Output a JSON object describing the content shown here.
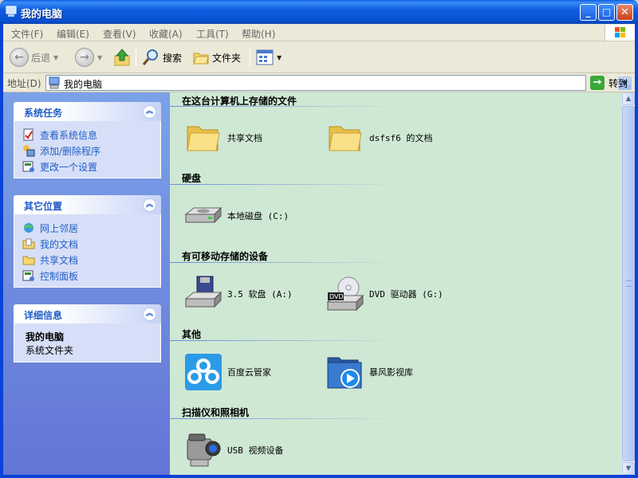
{
  "window": {
    "title": "我的电脑",
    "minimize": "_",
    "maximize": "□",
    "close": "✕"
  },
  "menu": [
    "文件(F)",
    "编辑(E)",
    "查看(V)",
    "收藏(A)",
    "工具(T)",
    "帮助(H)"
  ],
  "toolbar": {
    "back": "后退",
    "search": "搜索",
    "folders": "文件夹"
  },
  "address": {
    "label": "地址(D)",
    "value": "我的电脑",
    "go": "转到"
  },
  "left": {
    "system_tasks": {
      "title": "系统任务",
      "items": [
        "查看系统信息",
        "添加/删除程序",
        "更改一个设置"
      ]
    },
    "other_places": {
      "title": "其它位置",
      "items": [
        "网上邻居",
        "我的文档",
        "共享文档",
        "控制面板"
      ]
    },
    "details": {
      "title": "详细信息",
      "name": "我的电脑",
      "type": "系统文件夹"
    }
  },
  "groups": {
    "files": {
      "title": "在这台计算机上存储的文件",
      "items": [
        "共享文档",
        "dsfsf6 的文档"
      ]
    },
    "disks": {
      "title": "硬盘",
      "items": [
        "本地磁盘 (C:)"
      ]
    },
    "removable": {
      "title": "有可移动存储的设备",
      "items": [
        "3.5 软盘 (A:)",
        "DVD 驱动器 (G:)"
      ]
    },
    "other": {
      "title": "其他",
      "items": [
        "百度云管家",
        "暴风影视库"
      ]
    },
    "scanners": {
      "title": "扫描仪和照相机",
      "items": [
        "USB 视频设备"
      ]
    }
  },
  "colors": {
    "title_bar": "#0a5fe0",
    "task_link": "#215dc6",
    "content_bg": "#cfe8d4"
  }
}
